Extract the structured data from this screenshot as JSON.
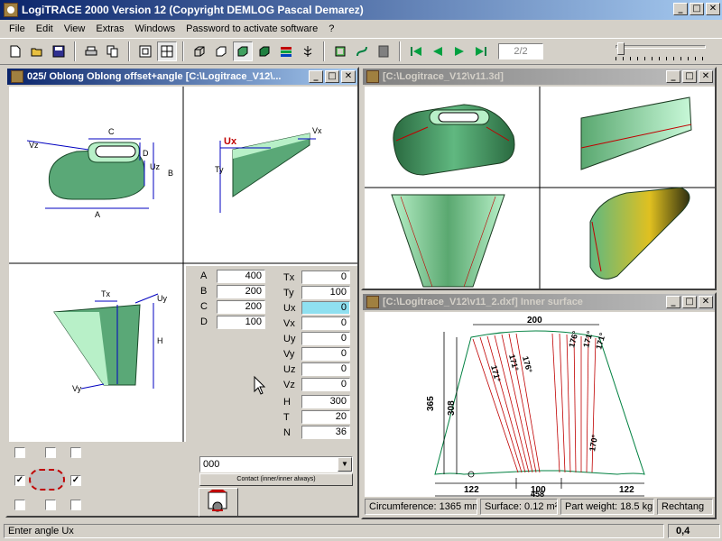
{
  "app": {
    "title": "LogiTRACE 2000  Version 12  (Copyright DEMLOG Pascal Demarez)",
    "window_buttons": [
      "_",
      "□",
      "✕"
    ]
  },
  "menu": [
    "File",
    "Edit",
    "View",
    "Extras",
    "Windows",
    "Password to activate software",
    "?"
  ],
  "toolbar": {
    "page_indicator": "2/2",
    "icons": [
      "new-file-icon",
      "open-folder-icon",
      "save-icon",
      "print-icon",
      "copy-icon",
      "single-view-icon",
      "quad-view-icon",
      "box-wire-icon",
      "box-outline-icon",
      "box-shaded-icon",
      "box-solid-icon",
      "color-stripes-icon",
      "tree-icon",
      "frame-icon",
      "curve-icon",
      "grey-box-icon",
      "first-page-icon",
      "previous-page-icon",
      "next-page-icon",
      "last-page-icon"
    ]
  },
  "child_main": {
    "title": "025/ Oblong Oblong offset+angle  [C:\\Logitrace_V12\\...",
    "fields_left": [
      {
        "label": "A",
        "value": "400"
      },
      {
        "label": "B",
        "value": "200"
      },
      {
        "label": "C",
        "value": "200"
      },
      {
        "label": "D",
        "value": "100"
      }
    ],
    "fields_right": [
      {
        "label": "Tx",
        "value": "0"
      },
      {
        "label": "Ty",
        "value": "100"
      },
      {
        "label": "Ux",
        "value": "0"
      },
      {
        "label": "Vx",
        "value": "0"
      },
      {
        "label": "Uy",
        "value": "0"
      },
      {
        "label": "Vy",
        "value": "0"
      },
      {
        "label": "Uz",
        "value": "0"
      },
      {
        "label": "Vz",
        "value": "0"
      },
      {
        "label": "H",
        "value": "300"
      },
      {
        "label": "T",
        "value": "20"
      },
      {
        "label": "N",
        "value": "36"
      }
    ],
    "combo_value": "000",
    "contact_button": "Contact (inner/inner always)",
    "drawing_labels": {
      "front": [
        "C",
        "D",
        "B",
        "A",
        "Vz",
        "Uz"
      ],
      "side": [
        "Ux",
        "Vx",
        "Ty"
      ],
      "bottom": [
        "Tx",
        "Uy",
        "H",
        "Vy"
      ]
    }
  },
  "child_3d": {
    "title": "[C:\\Logitrace_V12\\v11.3d]"
  },
  "child_dxf": {
    "title": "[C:\\Logitrace_V12\\v11_2.dxf]  Inner surface",
    "dims": {
      "top": "200",
      "left_outer": "365",
      "left_inner": "308",
      "bottom_left": "122",
      "bottom_mid": "100",
      "bottom_right": "122",
      "total": "458"
    },
    "angle_labels": [
      "171°",
      "171°",
      "176°",
      "171°",
      "171°",
      "176°",
      "170°"
    ],
    "info": [
      "Circumference: 1365 mm",
      "Surface: 0.12 m²",
      "Part weight: 18.5 kg",
      "Rechtang"
    ]
  },
  "status": {
    "message": "Enter angle Ux",
    "value": "0,4"
  },
  "colors": {
    "title_active": "#0a246a",
    "title_inactive": "#808080",
    "face": "#d4d0c8",
    "highlight_field": "#8fe0f0",
    "shape_green": "#5aa877",
    "shape_light": "#b8f0c8",
    "dim_blue": "#0000c0",
    "curve_red": "#c00000"
  }
}
